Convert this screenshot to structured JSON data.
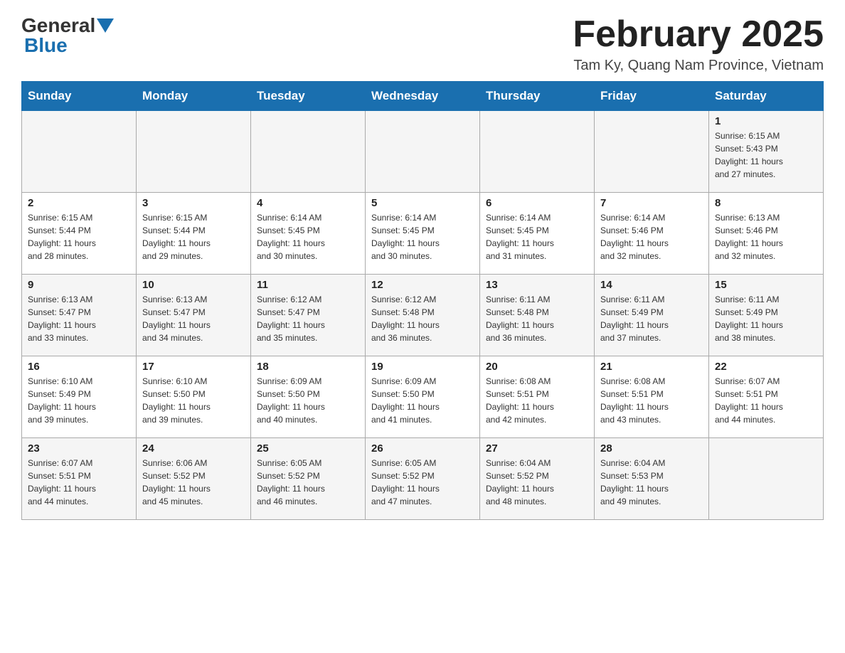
{
  "header": {
    "logo": {
      "text_general": "General",
      "text_blue": "Blue"
    },
    "title": "February 2025",
    "location": "Tam Ky, Quang Nam Province, Vietnam"
  },
  "days_of_week": [
    "Sunday",
    "Monday",
    "Tuesday",
    "Wednesday",
    "Thursday",
    "Friday",
    "Saturday"
  ],
  "weeks": [
    {
      "days": [
        {
          "num": "",
          "info": ""
        },
        {
          "num": "",
          "info": ""
        },
        {
          "num": "",
          "info": ""
        },
        {
          "num": "",
          "info": ""
        },
        {
          "num": "",
          "info": ""
        },
        {
          "num": "",
          "info": ""
        },
        {
          "num": "1",
          "info": "Sunrise: 6:15 AM\nSunset: 5:43 PM\nDaylight: 11 hours\nand 27 minutes."
        }
      ]
    },
    {
      "days": [
        {
          "num": "2",
          "info": "Sunrise: 6:15 AM\nSunset: 5:44 PM\nDaylight: 11 hours\nand 28 minutes."
        },
        {
          "num": "3",
          "info": "Sunrise: 6:15 AM\nSunset: 5:44 PM\nDaylight: 11 hours\nand 29 minutes."
        },
        {
          "num": "4",
          "info": "Sunrise: 6:14 AM\nSunset: 5:45 PM\nDaylight: 11 hours\nand 30 minutes."
        },
        {
          "num": "5",
          "info": "Sunrise: 6:14 AM\nSunset: 5:45 PM\nDaylight: 11 hours\nand 30 minutes."
        },
        {
          "num": "6",
          "info": "Sunrise: 6:14 AM\nSunset: 5:45 PM\nDaylight: 11 hours\nand 31 minutes."
        },
        {
          "num": "7",
          "info": "Sunrise: 6:14 AM\nSunset: 5:46 PM\nDaylight: 11 hours\nand 32 minutes."
        },
        {
          "num": "8",
          "info": "Sunrise: 6:13 AM\nSunset: 5:46 PM\nDaylight: 11 hours\nand 32 minutes."
        }
      ]
    },
    {
      "days": [
        {
          "num": "9",
          "info": "Sunrise: 6:13 AM\nSunset: 5:47 PM\nDaylight: 11 hours\nand 33 minutes."
        },
        {
          "num": "10",
          "info": "Sunrise: 6:13 AM\nSunset: 5:47 PM\nDaylight: 11 hours\nand 34 minutes."
        },
        {
          "num": "11",
          "info": "Sunrise: 6:12 AM\nSunset: 5:47 PM\nDaylight: 11 hours\nand 35 minutes."
        },
        {
          "num": "12",
          "info": "Sunrise: 6:12 AM\nSunset: 5:48 PM\nDaylight: 11 hours\nand 36 minutes."
        },
        {
          "num": "13",
          "info": "Sunrise: 6:11 AM\nSunset: 5:48 PM\nDaylight: 11 hours\nand 36 minutes."
        },
        {
          "num": "14",
          "info": "Sunrise: 6:11 AM\nSunset: 5:49 PM\nDaylight: 11 hours\nand 37 minutes."
        },
        {
          "num": "15",
          "info": "Sunrise: 6:11 AM\nSunset: 5:49 PM\nDaylight: 11 hours\nand 38 minutes."
        }
      ]
    },
    {
      "days": [
        {
          "num": "16",
          "info": "Sunrise: 6:10 AM\nSunset: 5:49 PM\nDaylight: 11 hours\nand 39 minutes."
        },
        {
          "num": "17",
          "info": "Sunrise: 6:10 AM\nSunset: 5:50 PM\nDaylight: 11 hours\nand 39 minutes."
        },
        {
          "num": "18",
          "info": "Sunrise: 6:09 AM\nSunset: 5:50 PM\nDaylight: 11 hours\nand 40 minutes."
        },
        {
          "num": "19",
          "info": "Sunrise: 6:09 AM\nSunset: 5:50 PM\nDaylight: 11 hours\nand 41 minutes."
        },
        {
          "num": "20",
          "info": "Sunrise: 6:08 AM\nSunset: 5:51 PM\nDaylight: 11 hours\nand 42 minutes."
        },
        {
          "num": "21",
          "info": "Sunrise: 6:08 AM\nSunset: 5:51 PM\nDaylight: 11 hours\nand 43 minutes."
        },
        {
          "num": "22",
          "info": "Sunrise: 6:07 AM\nSunset: 5:51 PM\nDaylight: 11 hours\nand 44 minutes."
        }
      ]
    },
    {
      "days": [
        {
          "num": "23",
          "info": "Sunrise: 6:07 AM\nSunset: 5:51 PM\nDaylight: 11 hours\nand 44 minutes."
        },
        {
          "num": "24",
          "info": "Sunrise: 6:06 AM\nSunset: 5:52 PM\nDaylight: 11 hours\nand 45 minutes."
        },
        {
          "num": "25",
          "info": "Sunrise: 6:05 AM\nSunset: 5:52 PM\nDaylight: 11 hours\nand 46 minutes."
        },
        {
          "num": "26",
          "info": "Sunrise: 6:05 AM\nSunset: 5:52 PM\nDaylight: 11 hours\nand 47 minutes."
        },
        {
          "num": "27",
          "info": "Sunrise: 6:04 AM\nSunset: 5:52 PM\nDaylight: 11 hours\nand 48 minutes."
        },
        {
          "num": "28",
          "info": "Sunrise: 6:04 AM\nSunset: 5:53 PM\nDaylight: 11 hours\nand 49 minutes."
        },
        {
          "num": "",
          "info": ""
        }
      ]
    }
  ]
}
